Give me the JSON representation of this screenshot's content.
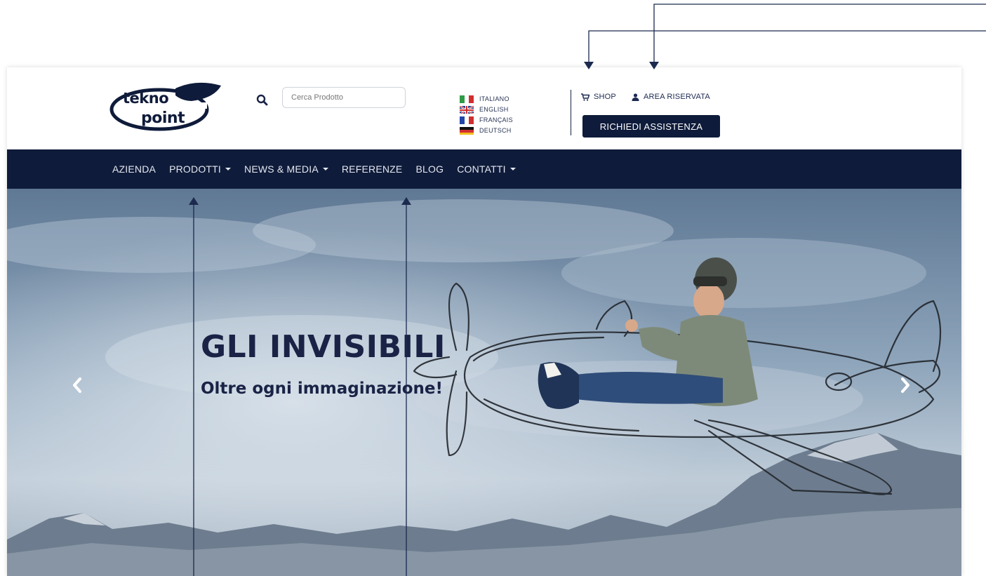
{
  "header": {
    "logo": {
      "line1": "tekno",
      "line2": "point"
    },
    "search": {
      "placeholder": "Cerca Prodotto",
      "value": ""
    },
    "languages": [
      {
        "label": "ITALIANO",
        "flag": "flag-it-icon"
      },
      {
        "label": "ENGLISH",
        "flag": "flag-uk-icon"
      },
      {
        "label": "FRANÇAIS",
        "flag": "flag-fr-icon"
      },
      {
        "label": "DEUTSCH",
        "flag": "flag-de-icon"
      }
    ],
    "links": {
      "shop": "SHOP",
      "area": "AREA RISERVATA"
    },
    "assist_button": "RICHIEDI ASSISTENZA"
  },
  "nav": {
    "items": [
      {
        "label": "AZIENDA",
        "dropdown": false
      },
      {
        "label": "PRODOTTI",
        "dropdown": true
      },
      {
        "label": "NEWS & MEDIA",
        "dropdown": true
      },
      {
        "label": "REFERENZE",
        "dropdown": false
      },
      {
        "label": "BLOG",
        "dropdown": false
      },
      {
        "label": "CONTATTI",
        "dropdown": true
      }
    ]
  },
  "hero": {
    "title": "GLI INVISIBILI",
    "subtitle": "Oltre ogni immaginazione!"
  },
  "colors": {
    "brand_navy": "#0f1b3a",
    "annotation": "#1b2a4e"
  }
}
